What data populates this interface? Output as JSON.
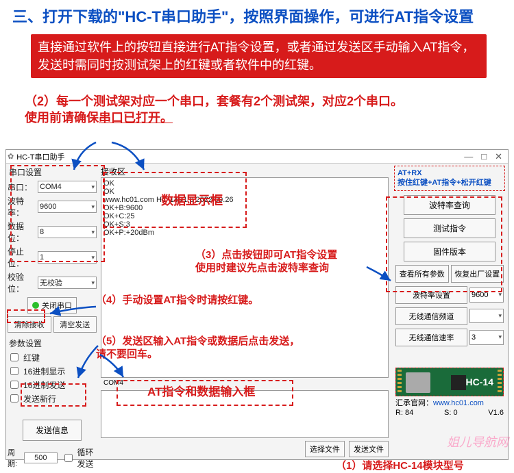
{
  "title": "三、打开下载的\"HC-T串口助手\"，按照界面操作，可进行AT指令设置",
  "redbox": "直接通过软件上的按钮直接进行AT指令设置，或者通过发送区手动输入AT指令，发送时需同时按测试架上的红键或者软件中的红键。",
  "note2a": "（2）每一个测试架对应一个串口，套餐有2个测试架，对应2个串口。",
  "note2b": "使用前请确保",
  "note2c": "串口已打开。",
  "app_title": "HC-T串口助手",
  "left": {
    "grp1": "串口设置",
    "port_l": "串口：",
    "port_v": "COM4",
    "baud_l": "波特率：",
    "baud_v": "9600",
    "data_l": "数据位：",
    "data_v": "8",
    "stop_l": "停止位：",
    "stop_v": "1",
    "chk_l": "校验位：",
    "chk_v": "无校验",
    "close": "关闭串口",
    "clear_rx": "清除接收",
    "clear_tx": "清空发送",
    "grp2": "参数设置",
    "redkey": "红键",
    "hex_disp": "16进制显示",
    "hex_send": "16进制发送",
    "newline": "发送新行",
    "send": "发送信息",
    "period_l": "周期:",
    "period_v": "500",
    "loop": "循环发送"
  },
  "mid": {
    "recv_l": "接收区",
    "recv_text": "OK\nOK\nwww.hc01.com HC-14V1.0 2022.09.26\nOK+B:9600\nOK+C:25\nOK+S:3\nOK+P:+20dBm",
    "com_l": "COM4",
    "sel_file": "选择文件",
    "send_file": "发送文件"
  },
  "right": {
    "atrx1": "AT+RX",
    "atrx2": "按住红键+AT指令+松开红键",
    "baud_q": "波特率查询",
    "test": "测试指令",
    "fw": "固件版本",
    "view_all": "查看所有参数",
    "factory": "恢复出厂设置",
    "baud_set": "波特率设置",
    "baud_set_v": "9600",
    "ch": "无线通信频道",
    "ch_v": "",
    "rate": "无线通信速率",
    "rate_v": "3",
    "hc14": "HC-14",
    "site_l": "汇承官网：",
    "site_v": "www.hc01.com",
    "r": "R: 84",
    "s": "S: 0",
    "ver": "V1.6"
  },
  "anno": {
    "a3a": "（3）点击按钮即可AT指令设置",
    "a3b": "使用时建议先点击波特率查询",
    "a4": "（4）手动设置AT指令时请按红键。",
    "a5a": "（5）发送区输入AT指令或数据后点击发送，",
    "a5b": "请不要回车。",
    "box1": "数据显示框",
    "box2": "AT指令和数据输入框",
    "a1": "（1）请选择HC-14模块型号"
  },
  "watermark": "姐儿导航网"
}
